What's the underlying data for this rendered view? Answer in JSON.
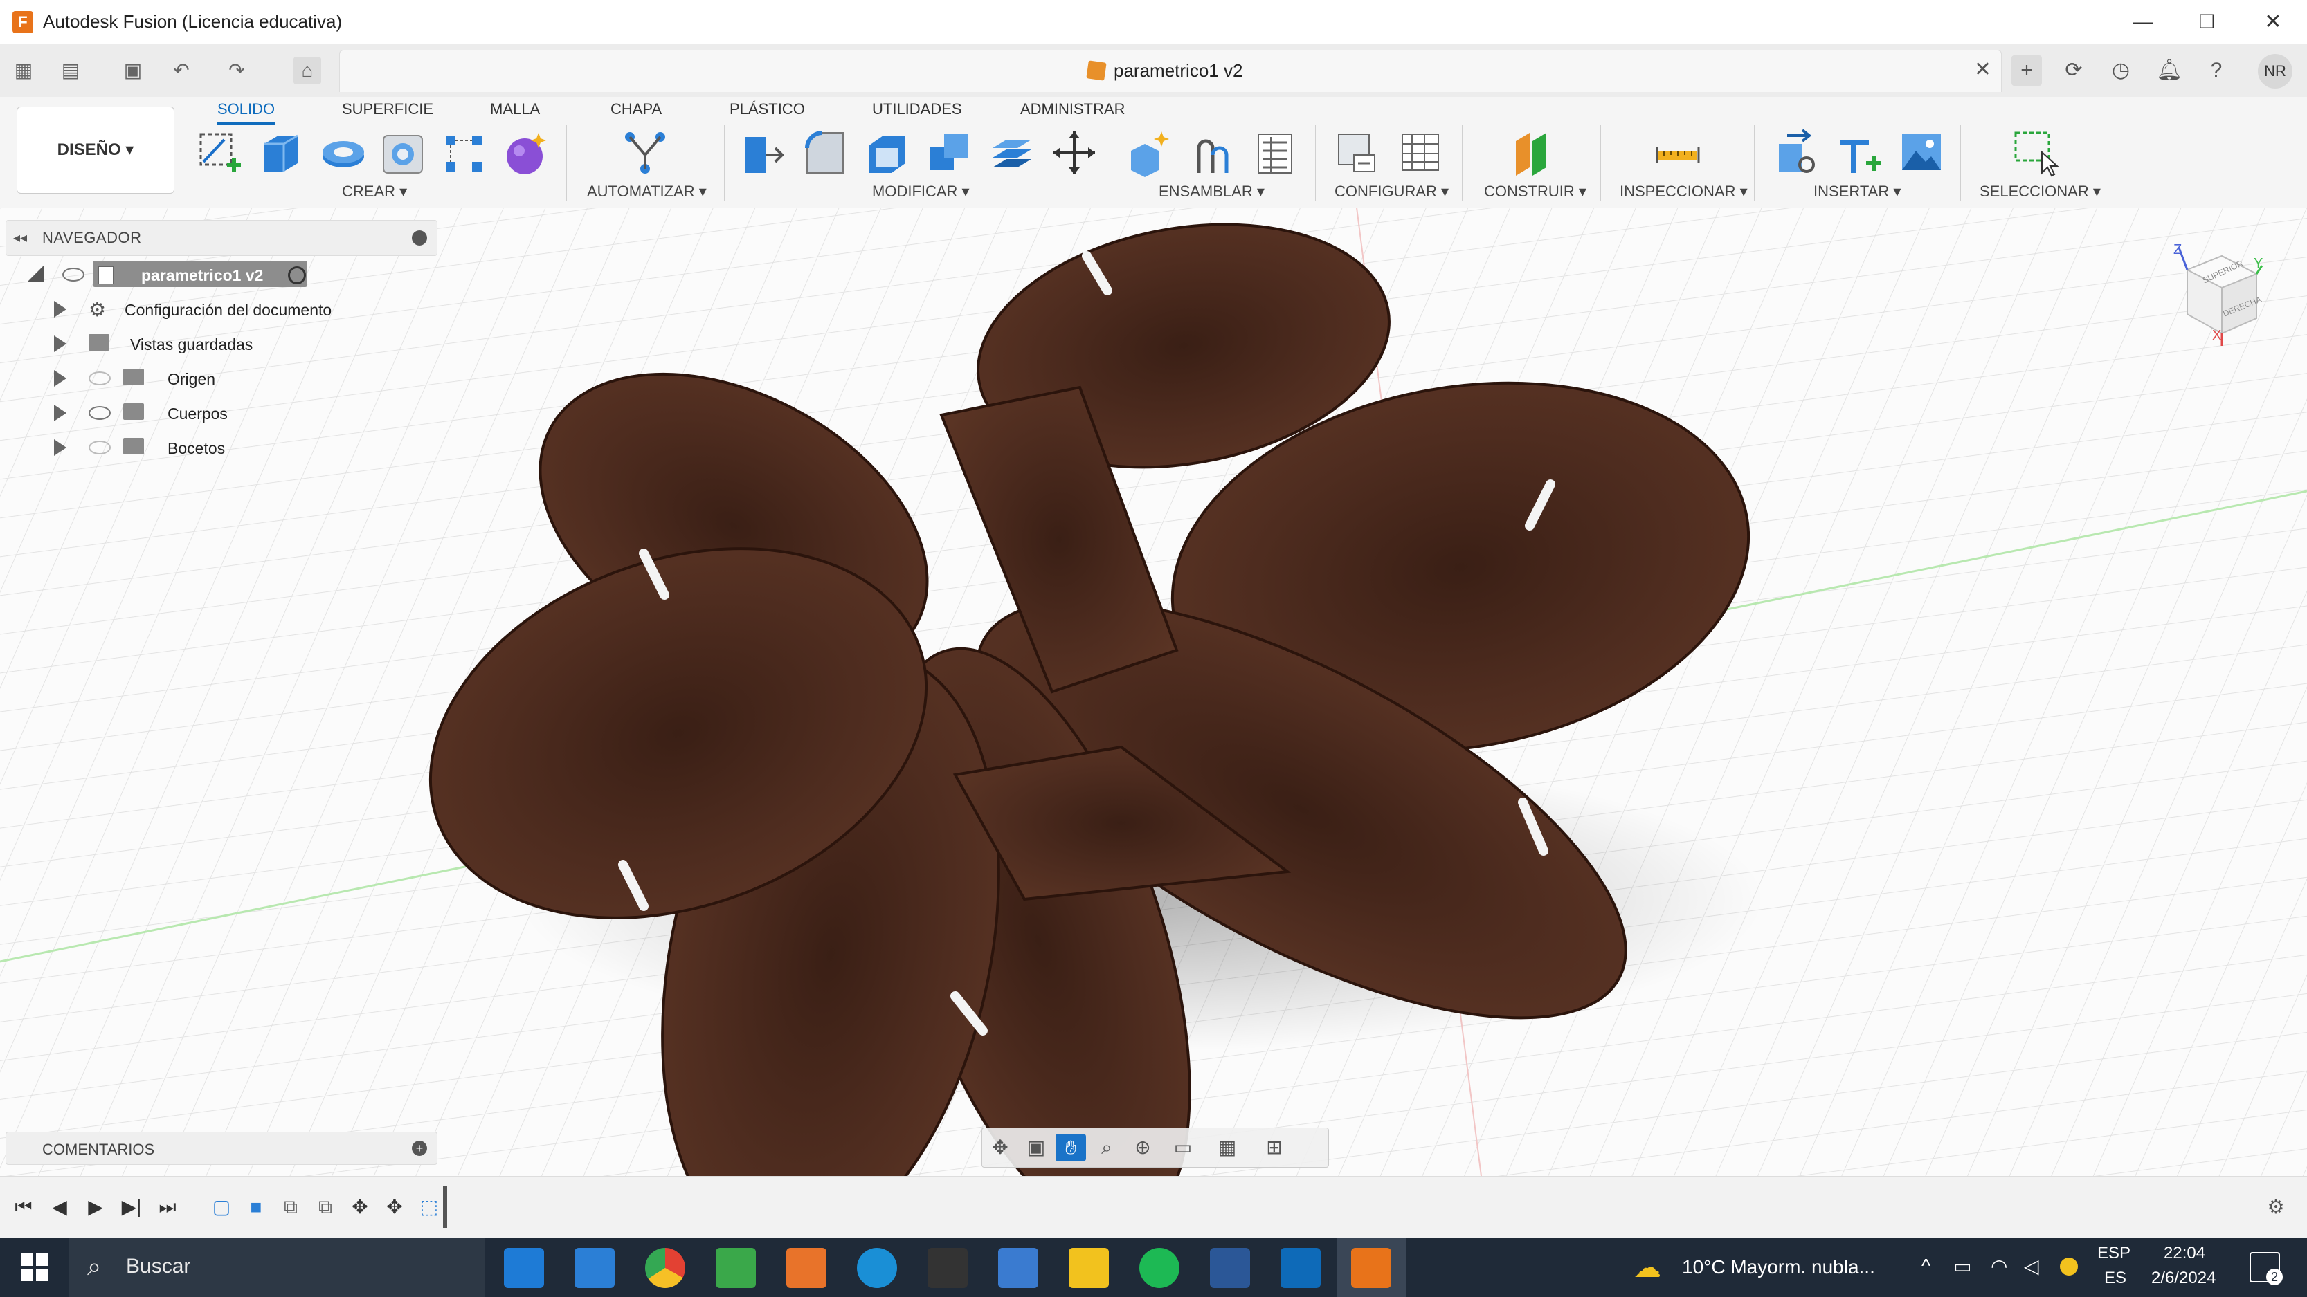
{
  "window": {
    "title": "Autodesk Fusion (Licencia educativa)",
    "logo_letter": "F",
    "controls": [
      "—",
      "☐",
      "✕"
    ]
  },
  "document": {
    "tab_title": "parametrico1 v2",
    "close_glyph": "✕"
  },
  "user": {
    "initials": "NR"
  },
  "ribbon": {
    "workspace": "DISEÑO ▾",
    "tabs": [
      "SOLIDO",
      "SUPERFICIE",
      "MALLA",
      "CHAPA",
      "PLÁSTICO",
      "UTILIDADES",
      "ADMINISTRAR"
    ],
    "active_tab": "SOLIDO",
    "groups": [
      "CREAR ▾",
      "AUTOMATIZAR ▾",
      "MODIFICAR ▾",
      "ENSAMBLAR ▾",
      "CONFIGURAR ▾",
      "CONSTRUIR ▾",
      "INSPECCIONAR ▾",
      "INSERTAR ▾",
      "SELECCIONAR ▾"
    ]
  },
  "navigator": {
    "title": "NAVEGADOR",
    "root": "parametrico1 v2",
    "items": [
      "Configuración del documento",
      "Vistas guardadas",
      "Origen",
      "Cuerpos",
      "Bocetos"
    ]
  },
  "viewcube": {
    "top": "SUPERIOR",
    "right": "DERECHA",
    "axis_z": "Z",
    "axis_y": "Y",
    "axis_x": "X"
  },
  "comments": {
    "title": "COMENTARIOS"
  },
  "taskbar": {
    "search_placeholder": "Buscar",
    "weather": "10°C  Mayorm. nubla...",
    "lang1": "ESP",
    "lang2": "ES",
    "time": "22:04",
    "date": "2/6/2024",
    "notif_count": "2"
  },
  "colors": {
    "accent": "#0f6cbd",
    "wood": "#4a2a1e",
    "taskbar": "#1f2a38"
  }
}
